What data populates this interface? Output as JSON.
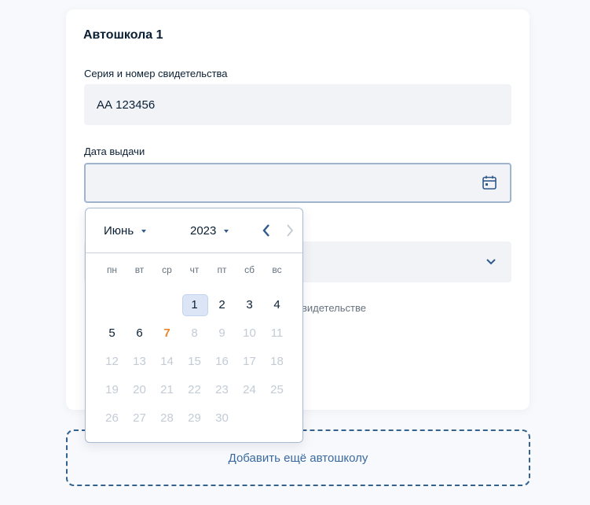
{
  "card": {
    "title": "Автошкола  1",
    "certificate": {
      "label": "Серия и номер свидетельства",
      "value": "АА 123456"
    },
    "issue_date": {
      "label": "Дата выдачи",
      "value": ""
    },
    "hint_partial": "видетельстве"
  },
  "add_button": "Добавить ещё автошколу",
  "datepicker": {
    "month": "Июнь",
    "year": "2023",
    "weekdays": [
      "пн",
      "вт",
      "ср",
      "чт",
      "пт",
      "сб",
      "вс"
    ],
    "weeks": [
      [
        {
          "d": "",
          "state": "empty"
        },
        {
          "d": "",
          "state": "empty"
        },
        {
          "d": "",
          "state": "empty"
        },
        {
          "d": "1",
          "state": "selected"
        },
        {
          "d": "2",
          "state": "normal"
        },
        {
          "d": "3",
          "state": "normal"
        },
        {
          "d": "4",
          "state": "normal"
        }
      ],
      [
        {
          "d": "5",
          "state": "normal"
        },
        {
          "d": "6",
          "state": "normal"
        },
        {
          "d": "7",
          "state": "today"
        },
        {
          "d": "8",
          "state": "disabled"
        },
        {
          "d": "9",
          "state": "disabled"
        },
        {
          "d": "10",
          "state": "disabled"
        },
        {
          "d": "11",
          "state": "disabled"
        }
      ],
      [
        {
          "d": "12",
          "state": "disabled"
        },
        {
          "d": "13",
          "state": "disabled"
        },
        {
          "d": "14",
          "state": "disabled"
        },
        {
          "d": "15",
          "state": "disabled"
        },
        {
          "d": "16",
          "state": "disabled"
        },
        {
          "d": "17",
          "state": "disabled"
        },
        {
          "d": "18",
          "state": "disabled"
        }
      ],
      [
        {
          "d": "19",
          "state": "disabled"
        },
        {
          "d": "20",
          "state": "disabled"
        },
        {
          "d": "21",
          "state": "disabled"
        },
        {
          "d": "22",
          "state": "disabled"
        },
        {
          "d": "23",
          "state": "disabled"
        },
        {
          "d": "24",
          "state": "disabled"
        },
        {
          "d": "25",
          "state": "disabled"
        }
      ],
      [
        {
          "d": "26",
          "state": "disabled"
        },
        {
          "d": "27",
          "state": "disabled"
        },
        {
          "d": "28",
          "state": "disabled"
        },
        {
          "d": "29",
          "state": "disabled"
        },
        {
          "d": "30",
          "state": "disabled"
        },
        {
          "d": "",
          "state": "empty"
        },
        {
          "d": "",
          "state": "empty"
        }
      ]
    ]
  },
  "icons": {
    "calendar": "calendar-icon",
    "chevron_down": "chevron-down-icon",
    "prev": "chevron-left-icon",
    "next": "chevron-right-icon"
  },
  "colors": {
    "accent": "#2f5a8c",
    "today": "#e8862b",
    "selected_bg": "#dbe5f6",
    "disabled": "#c3cbd5"
  }
}
